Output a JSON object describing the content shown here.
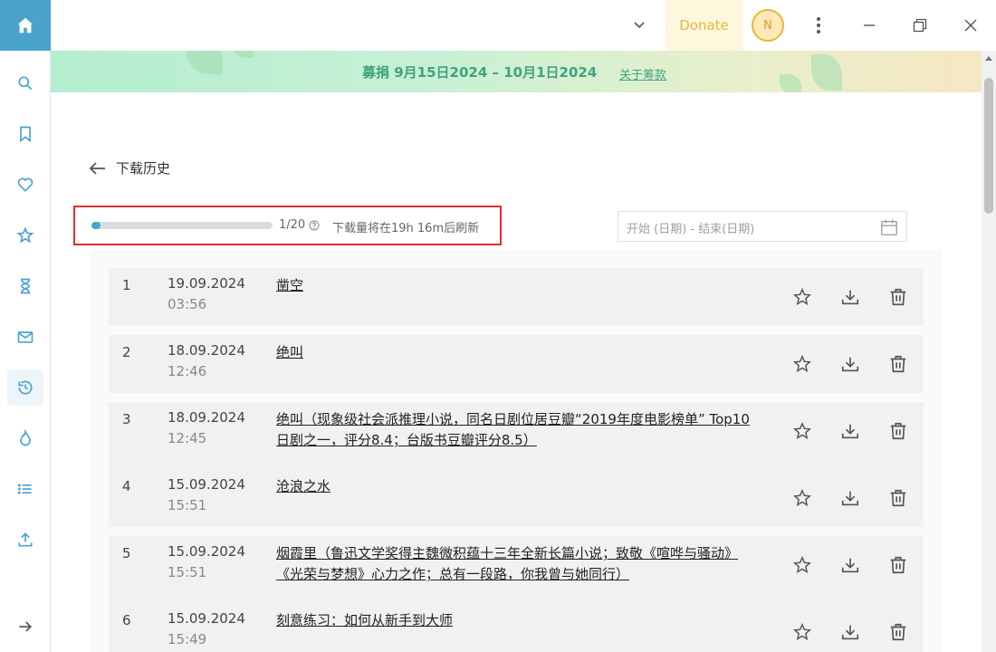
{
  "window": {
    "donate_label": "Donate",
    "avatar_initial": "N"
  },
  "banner": {
    "text": "募捐 9月15日2024 – 10月1日2024",
    "link": "关于筹款"
  },
  "sidebar": {
    "items": [
      "search-icon",
      "bookmark-icon",
      "heart-icon",
      "star-plus-icon",
      "hourglass-icon",
      "mail-icon",
      "history-icon",
      "flame-icon",
      "list-icon",
      "upload-icon"
    ],
    "active": "history-icon",
    "collapse": "arrow-right-icon"
  },
  "page": {
    "title": "下载历史"
  },
  "quota": {
    "used": 1,
    "total": 20,
    "count_label": "1/20",
    "refresh_text": "下载量将在19h 16m后刷新"
  },
  "date_filter": {
    "placeholder": "开始 (日期) - 结束(日期)"
  },
  "downloads": [
    {
      "num": "1",
      "date": "19.09.2024",
      "time": "03:56",
      "title": "凿空"
    },
    {
      "num": "2",
      "date": "18.09.2024",
      "time": "12:46",
      "title": "绝叫"
    },
    {
      "num": "3",
      "date": "18.09.2024",
      "time": "12:45",
      "title": "绝叫（现象级社会派推理小说，同名日剧位居豆瓣“2019年度电影榜单” Top10日剧之一，评分8.4；台版书豆瓣评分8.5）"
    },
    {
      "num": "4",
      "date": "15.09.2024",
      "time": "15:51",
      "title": "沧浪之水"
    },
    {
      "num": "5",
      "date": "15.09.2024",
      "time": "15:51",
      "title": "烟霞里（鲁迅文学奖得主魏微积蕴十三年全新长篇小说；致敬《喧哗与骚动》《光荣与梦想》心力之作；总有一段路，你我曾与她同行）"
    },
    {
      "num": "6",
      "date": "15.09.2024",
      "time": "15:49",
      "title": "刻意练习：如何从新手到大师"
    }
  ],
  "colors": {
    "accent": "#4aa3cd",
    "highlight_border": "#e02d2d",
    "donate_bg": "#fdf7dd",
    "banner_text": "#3fa37e"
  }
}
